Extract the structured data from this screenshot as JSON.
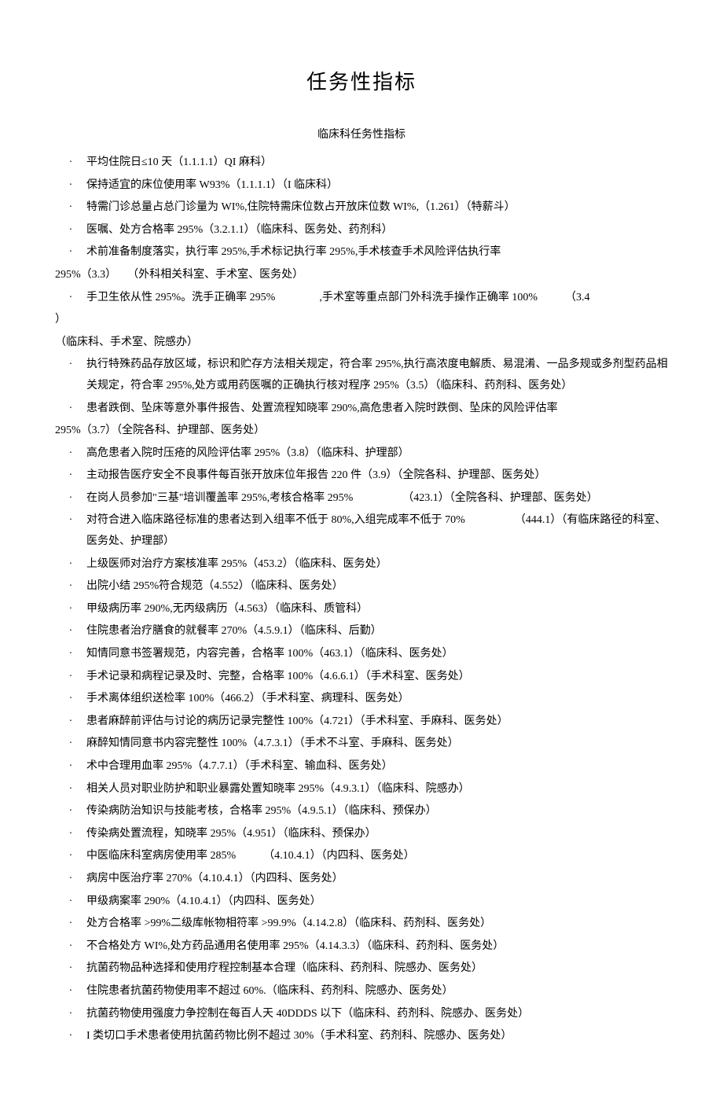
{
  "title": "任务性指标",
  "subtitle": "临床科任务性指标",
  "items": [
    {
      "type": "bullet",
      "text": "平均住院日≤10 天（1.1.1.1）QI 麻科）"
    },
    {
      "type": "bullet",
      "text": "保持适宜的床位使用率 W93%（1.1.1.1）（I 临床科）"
    },
    {
      "type": "bullet",
      "text": "特需门诊总量占总门诊量为 WI%,住院特需床位数占开放床位数 WI%,（1.261）（特薪斗）"
    },
    {
      "type": "bullet",
      "text": "医嘱、处方合格率 295%（3.2.1.1）（临床科、医务处、药剂科）"
    },
    {
      "type": "bullet",
      "text": "术前准备制度落实，执行率 295%,手术标记执行率 295%,手术核查手术风险评估执行率"
    },
    {
      "type": "cont",
      "text": "295%（3.3）　　（外科相关科室、手术室、医务处）"
    },
    {
      "type": "bullet",
      "text": "手卫生依从性 295%。洗手正确率 295%　　　　,手术室等重点部门外科洗手操作正确率 100%　　　（3.4"
    },
    {
      "type": "cont",
      "text": "）"
    },
    {
      "type": "cont",
      "text": "（临床科、手术室、院感办）"
    },
    {
      "type": "bullet",
      "text": "执行特殊药品存放区域，标识和贮存方法相关规定，符合率 295%,执行高浓度电解质、易混淆、一品多规或多剂型药品相关规定，符合率 295%,处方或用药医嘱的正确执行核对程序 295%（3.5）（临床科、药剂科、医务处）"
    },
    {
      "type": "bullet",
      "text": "患者跌倒、坠床等意外事件报告、处置流程知晓率 290%,高危患者入院时跌倒、坠床的风险评估率"
    },
    {
      "type": "cont",
      "text": "295%（3.7）（全院各科、护理部、医务处）"
    },
    {
      "type": "bullet",
      "text": "高危患者入院时压疮的风险评估率 295%（3.8）（临床科、护理部）"
    },
    {
      "type": "bullet",
      "text": "主动报告医疗安全不良事件每百张开放床位年报告 220 件（3.9）（全院各科、护理部、医务处）"
    },
    {
      "type": "bullet",
      "text": "在岗人员参加\"三基\"培训覆盖率 295%,考核合格率 295%　　　　　（423.1）（全院各科、护理部、医务处）"
    },
    {
      "type": "bullet",
      "text": "对符合进入临床路径标准的患者达到入组率不低于 80%,入组完成率不低于 70%　　　　　（444.1）（有临床路径的科室、医务处、护理部）"
    },
    {
      "type": "bullet",
      "text": "上级医师对治疗方案核准率 295%（453.2）（临床科、医务处）"
    },
    {
      "type": "bullet",
      "text": "出院小结 295%符合规范（4.552）（临床科、医务处）"
    },
    {
      "type": "bullet",
      "text": "甲级病历率 290%,无丙级病历（4.563）（临床科、质管科）"
    },
    {
      "type": "bullet",
      "text": "住院患者治疗膳食的就餐率 270%（4.5.9.1）（临床科、后勤）"
    },
    {
      "type": "bullet",
      "text": "知情同意书签署规范，内容完善，合格率 100%（463.1）（临床科、医务处）"
    },
    {
      "type": "bullet",
      "text": "手术记录和病程记录及时、完整，合格率 100%（4.6.6.1）（手术科室、医务处）"
    },
    {
      "type": "bullet",
      "text": "手术离体组织送检率 100%（466.2）（手术科室、病理科、医务处）"
    },
    {
      "type": "bullet",
      "text": "患者麻醉前评估与讨论的病历记录完整性 100%（4.721）（手术科室、手麻科、医务处）"
    },
    {
      "type": "bullet",
      "text": "麻醉知情同意书内容完整性 100%（4.7.3.1）（手术不斗室、手麻科、医务处）"
    },
    {
      "type": "bullet",
      "text": "术中合理用血率 295%（4.7.7.1）（手术科室、输血科、医务处）"
    },
    {
      "type": "bullet",
      "text": "相关人员对职业防护和职业暴露处置知晓率 295%（4.9.3.1）（临床科、院感办）"
    },
    {
      "type": "bullet",
      "text": "传染病防治知识与技能考核，合格率 295%（4.9.5.1）（临床科、预保办）"
    },
    {
      "type": "bullet",
      "text": "传染病处置流程，知晓率 295%（4.951）（临床科、预保办）"
    },
    {
      "type": "bullet",
      "text": "中医临床科室病房使用率 285%　　　（4.10.4.1）（内四科、医务处）"
    },
    {
      "type": "bullet",
      "text": "病房中医治疗率 270%（4.10.4.1）（内四科、医务处）"
    },
    {
      "type": "bullet",
      "text": "甲级病案率 290%（4.10.4.1）（内四科、医务处）"
    },
    {
      "type": "bullet",
      "text": "处方合格率 >99%二级库帐物相符率 >99.9%（4.14.2.8）（临床科、药剂科、医务处）"
    },
    {
      "type": "bullet",
      "text": "不合格处方 WI%,处方药品通用名使用率 295%（4.14.3.3）（临床科、药剂科、医务处）"
    },
    {
      "type": "bullet",
      "text": "抗菌药物品种选择和使用疗程控制基本合理（临床科、药剂科、院感办、医务处）"
    },
    {
      "type": "bullet",
      "text": "住院患者抗菌药物使用率不超过 60%.（临床科、药剂科、院感办、医务处）"
    },
    {
      "type": "bullet",
      "text": "抗菌药物使用强度力争控制在每百人天 40DDDS 以下（临床科、药剂科、院感办、医务处）"
    },
    {
      "type": "bullet",
      "text": "I 类切口手术患者使用抗菌药物比例不超过 30%（手术科室、药剂科、院感办、医务处）"
    }
  ]
}
